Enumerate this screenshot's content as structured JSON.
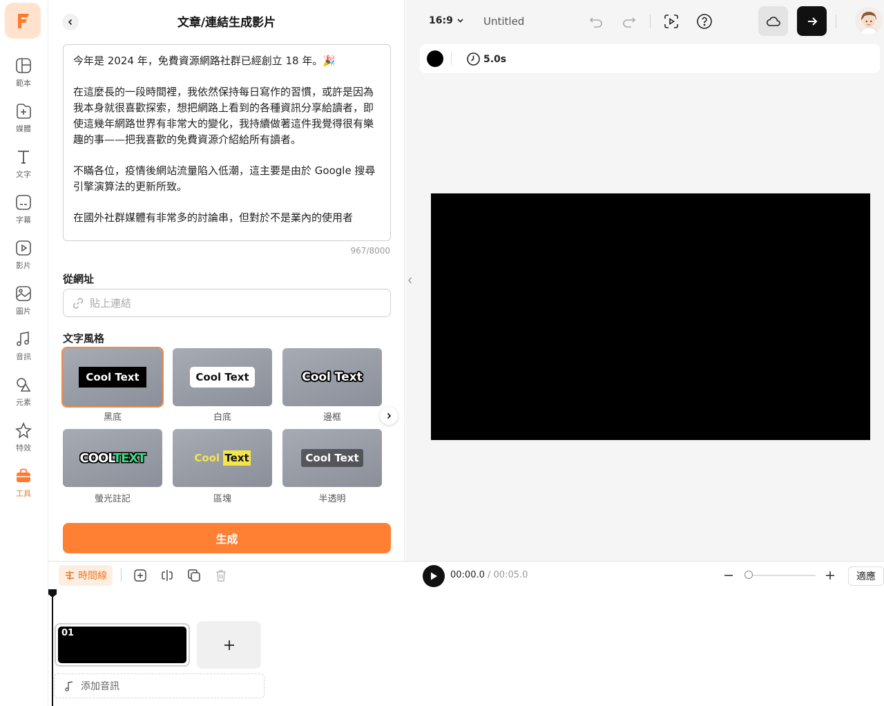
{
  "colors": {
    "accent": "#ff8033",
    "canvas": "#000000",
    "selected_outline": "#f08a4b"
  },
  "rail": {
    "items": [
      {
        "label": "範本",
        "icon": "template-icon"
      },
      {
        "label": "媒體",
        "icon": "media-add-icon"
      },
      {
        "label": "文字",
        "icon": "text-icon"
      },
      {
        "label": "字幕",
        "icon": "subtitle-icon"
      },
      {
        "label": "影片",
        "icon": "video-icon"
      },
      {
        "label": "圖片",
        "icon": "image-icon"
      },
      {
        "label": "音訊",
        "icon": "music-icon"
      },
      {
        "label": "元素",
        "icon": "elements-icon"
      },
      {
        "label": "特效",
        "icon": "effects-icon"
      },
      {
        "label": "工具",
        "icon": "toolbox-icon"
      }
    ]
  },
  "panel": {
    "title": "文章/連結生成影片",
    "paragraphs": [
      "今年是 2024 年，免費資源網路社群已經創立 18 年。🎉",
      "在這麼長的一段時間裡，我依然保持每日寫作的習慣，或許是因為我本身就很喜歡探索，想把網路上看到的各種資訊分享給讀者，即使這幾年網路世界有非常大的變化，我持續做著這件我覺得很有樂趣的事——把我喜歡的免費資源介紹給所有讀者。",
      "不瞞各位，疫情後網站流量陷入低潮，這主要是由於 Google 搜尋引擎演算法的更新所致。",
      "在國外社群媒體有非常多的討論串，但對於不是業內的使用者"
    ],
    "char_count": "967/8000",
    "url_label": "從網址",
    "url_placeholder": "貼上連結",
    "style_label": "文字風格",
    "styles": [
      {
        "name": "黑底",
        "sample": "Cool Text"
      },
      {
        "name": "白底",
        "sample": "Cool Text"
      },
      {
        "name": "邊框",
        "sample": "Cool Text"
      },
      {
        "name": "螢光註記",
        "sample_a": "COOL",
        "sample_b": "TEXT"
      },
      {
        "name": "區塊",
        "sample_a": "Cool",
        "sample_b": "Text"
      },
      {
        "name": "半透明",
        "sample": "Cool Text"
      }
    ],
    "generate_label": "生成"
  },
  "topbar": {
    "ratio": "16:9",
    "doc_title": "Untitled"
  },
  "propbar": {
    "duration": "5.0s"
  },
  "timeline": {
    "tag": "時間線",
    "current_time": "00:00.0",
    "total_time": "/ 00:05.0",
    "fit_label": "適應",
    "clip_number": "01",
    "add_audio": "添加音訊",
    "zoom_level": 0
  }
}
